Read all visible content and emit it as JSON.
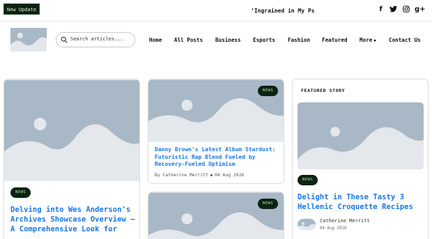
{
  "topbar": {
    "update_label": "New Update",
    "ticker_text": "‘Ingrained in My Ps",
    "socials": [
      {
        "icon": "facebook-icon",
        "glyph": "f"
      },
      {
        "icon": "twitter-icon",
        "glyph": "t"
      },
      {
        "icon": "instagram-icon",
        "glyph": "◎"
      },
      {
        "icon": "google-plus-icon",
        "glyph": "g+"
      }
    ]
  },
  "header": {
    "search_placeholder": "Search articles...",
    "nav": [
      {
        "label": "Home"
      },
      {
        "label": "All Posts"
      },
      {
        "label": "Business"
      },
      {
        "label": "Esports"
      },
      {
        "label": "Fashion"
      },
      {
        "label": "Featured"
      },
      {
        "label": "More",
        "has_dropdown": true
      },
      {
        "label": "Contact Us"
      }
    ]
  },
  "posts": {
    "left": {
      "badge": "NEWS",
      "title": "Delving into Wes Anderson's Archives Showcase Overview – A Comprehensive Look for"
    },
    "middle_top": {
      "badge": "NEWS",
      "title": "Danny Brown's Latest Album Stardust: Futuristic Rap Blend Fueled by Recovery-Fueled Optimism",
      "author": "By Catherine Merritt",
      "date": "04 Aug 2026"
    },
    "middle_bottom": {
      "badge": "NEWS"
    }
  },
  "featured": {
    "label": "FEATURED STORY",
    "badge": "NEWS",
    "title": "Delight in These Tasty 3 Hellenic Croquette Recipes",
    "author": "Catherine Merritt",
    "date": "04 Aug 2026"
  },
  "colors": {
    "accent": "#1b77e6",
    "badge_bg": "#0d2313",
    "badge_text": "#a9e3a0",
    "placeholder_sky": "#a9b8c6",
    "placeholder_hill": "#e4e7eb"
  }
}
